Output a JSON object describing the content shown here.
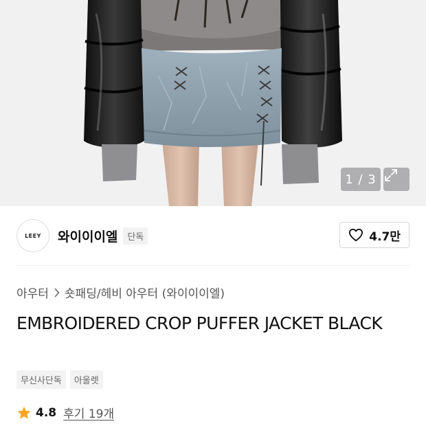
{
  "gallery": {
    "current": 1,
    "total": 3,
    "counter_label": "1 / 3",
    "expand_icon": "expand-icon"
  },
  "brand": {
    "logo_text": "LEEY",
    "name": "와이이이엘",
    "exclusive_tag": "단독",
    "like_icon": "heart-outline-icon",
    "like_count": "4.7만"
  },
  "breadcrumb": {
    "category": "아우터",
    "separator_icon": "chevron-right-icon",
    "subcategory": "숏패딩/헤비 아우터 (와이이이엘)"
  },
  "product": {
    "title": "EMBROIDERED CROP PUFFER JACKET BLACK"
  },
  "tags": [
    "무신사단독",
    "아울렛"
  ],
  "rating": {
    "star_icon": "star-icon",
    "score": "4.8",
    "reviews_label": "후기 19개"
  },
  "colors": {
    "star": "#f5a623",
    "photo_bg": "#f1f1f2",
    "puffer": "#1a1a1a",
    "skirt": "#8fa0ad"
  }
}
